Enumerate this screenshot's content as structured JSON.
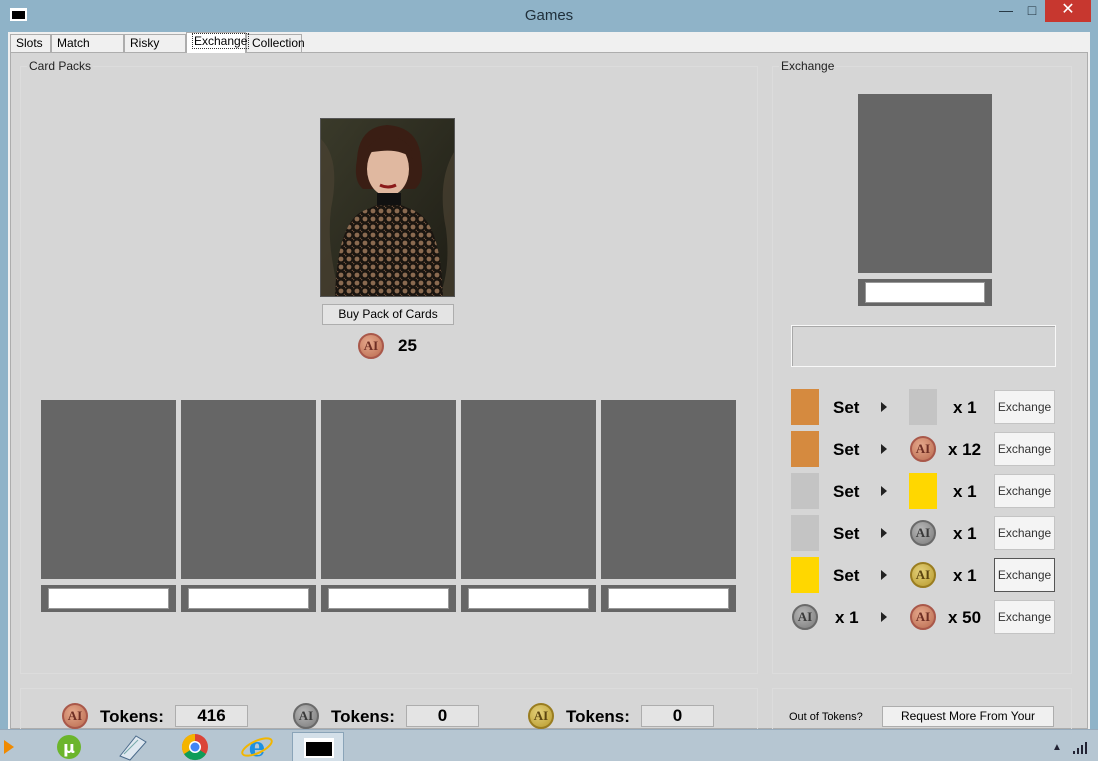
{
  "window": {
    "title": "Games"
  },
  "tabs": [
    {
      "label": "Slots"
    },
    {
      "label": "Match Game"
    },
    {
      "label": "Risky Pick"
    },
    {
      "label": "Exchange"
    },
    {
      "label": "Collection"
    }
  ],
  "card_packs": {
    "group_label": "Card Packs",
    "buy_button": "Buy Pack of Cards",
    "price": "25",
    "coin_text": "AI"
  },
  "exchange": {
    "group_label": "Exchange",
    "rows": [
      {
        "left_label": "Set",
        "left_color": "#d58a3f",
        "right_qty": "x 1",
        "right_kind": "swatch",
        "right_color": "#c4c4c4",
        "button": "Exchange"
      },
      {
        "left_label": "Set",
        "left_color": "#d58a3f",
        "right_qty": "x 12",
        "right_kind": "bronze-coin",
        "button": "Exchange"
      },
      {
        "left_label": "Set",
        "left_color": "#c4c4c4",
        "right_qty": "x 1",
        "right_kind": "swatch",
        "right_color": "#ffd700",
        "button": "Exchange"
      },
      {
        "left_label": "Set",
        "left_color": "#c4c4c4",
        "right_qty": "x 1",
        "right_kind": "silver-coin",
        "button": "Exchange"
      },
      {
        "left_label": "Set",
        "left_color": "#ffd700",
        "right_qty": "x 1",
        "right_kind": "gold-coin",
        "button": "Exchange"
      },
      {
        "left_label": "x 1",
        "left_kind": "silver-coin",
        "right_qty": "x 50",
        "right_kind": "bronze-coin",
        "button": "Exchange"
      }
    ]
  },
  "tokens": {
    "label": "Tokens:",
    "bronze": "416",
    "silver": "0",
    "gold": "0"
  },
  "request": {
    "label": "Out of Tokens?",
    "button": "Request More From Your Domme!"
  },
  "taskbar": {
    "items": [
      "media-player-icon",
      "utorrent-icon",
      "notepad-icon",
      "chrome-icon",
      "internet-explorer-icon",
      "games-app-icon"
    ]
  }
}
